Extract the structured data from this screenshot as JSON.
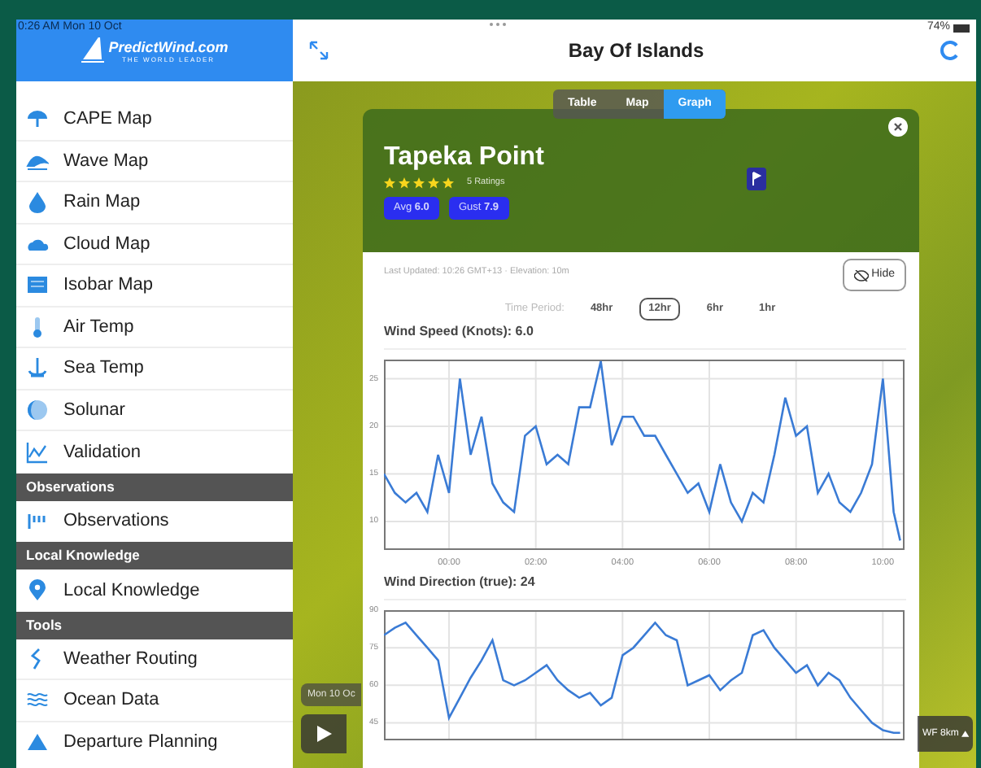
{
  "status_bar": {
    "time": "0:26 AM  Mon 10 Oct",
    "battery": "74%"
  },
  "sidebar": {
    "logo": {
      "name": "PredictWind.com",
      "tagline": "THE WORLD LEADER"
    },
    "sections": [
      {
        "items": [
          {
            "label": "CAPE Map"
          },
          {
            "label": "Wave Map"
          },
          {
            "label": "Rain Map"
          },
          {
            "label": "Cloud Map"
          },
          {
            "label": "Isobar Map"
          },
          {
            "label": "Air Temp"
          },
          {
            "label": "Sea Temp"
          },
          {
            "label": "Solunar"
          },
          {
            "label": "Validation"
          }
        ]
      },
      {
        "heading": "Observations",
        "items": [
          {
            "label": "Observations"
          }
        ]
      },
      {
        "heading": "Local Knowledge",
        "items": [
          {
            "label": "Local Knowledge"
          }
        ]
      },
      {
        "heading": "Tools",
        "items": [
          {
            "label": "Weather Routing"
          },
          {
            "label": "Ocean Data"
          },
          {
            "label": "Departure Planning"
          }
        ]
      }
    ]
  },
  "title_bar": {
    "title": "Bay Of Islands"
  },
  "view_tabs": [
    {
      "label": "Table",
      "selected": false
    },
    {
      "label": "Map",
      "selected": false
    },
    {
      "label": "Graph",
      "selected": true
    }
  ],
  "station_card": {
    "name": "Tapeka Point",
    "stars": 5,
    "ratings": "5 Ratings",
    "avg": "Avg **6.0**",
    "gust": "Gust **7.9**",
    "updated": "Last Updated: 10:26 GMT+13 · Elevation: 10m",
    "hide_button": "Hide",
    "time_period_label": "Time Period:",
    "periods": [
      {
        "label": "48hr",
        "selected": false
      },
      {
        "label": "12hr",
        "selected": true
      },
      {
        "label": "6hr",
        "selected": false
      },
      {
        "label": "1hr",
        "selected": false
      }
    ],
    "charts": [
      {
        "title": "Wind Speed (Knots): 6.0",
        "chart_data": {
          "type": "line",
          "x": [
            -1.5,
            -1.25,
            -1,
            -0.75,
            -0.5,
            -0.25,
            0,
            0.25,
            0.5,
            0.75,
            1,
            1.25,
            1.5,
            1.75,
            2,
            2.25,
            2.5,
            2.75,
            3,
            3.25,
            3.5,
            3.75,
            4,
            4.25,
            4.5,
            4.75,
            5,
            5.25,
            5.5,
            5.75,
            6,
            6.25,
            6.5,
            6.75,
            7,
            7.25,
            7.5,
            7.75,
            8,
            8.25,
            8.5,
            8.75,
            9,
            9.25,
            9.5,
            9.75,
            10,
            10.25,
            10.4
          ],
          "xlim": [
            -1.5,
            10.5
          ],
          "ylim": [
            7,
            27
          ],
          "grid": true,
          "xticks": [
            {
              "value": 0,
              "label": "00:00"
            },
            {
              "value": 2,
              "label": "02:00"
            },
            {
              "value": 4,
              "label": "04:00"
            },
            {
              "value": 6,
              "label": "06:00"
            },
            {
              "value": 8,
              "label": "08:00"
            },
            {
              "value": 10,
              "label": "10:00"
            }
          ],
          "yticks": [
            10,
            15,
            20,
            25
          ],
          "series": [
            {
              "color": "#3a7bd5",
              "values": [
                15,
                13,
                12,
                13,
                11,
                17,
                13,
                25,
                17,
                21,
                14,
                12,
                11,
                19,
                20,
                16,
                17,
                16,
                22,
                22,
                27,
                18,
                21,
                21,
                19,
                19,
                17,
                15,
                13,
                14,
                11,
                16,
                12,
                10,
                13,
                12,
                17,
                23,
                19,
                20,
                13,
                15,
                12,
                11,
                13,
                16,
                25,
                11,
                8
              ]
            }
          ]
        }
      },
      {
        "title": "Wind Direction (true): 24",
        "chart_data": {
          "type": "line",
          "x": [
            -1.5,
            -1.25,
            -1,
            -0.75,
            -0.5,
            -0.25,
            0,
            0.25,
            0.5,
            0.75,
            1,
            1.25,
            1.5,
            1.75,
            2,
            2.25,
            2.5,
            2.75,
            3,
            3.25,
            3.5,
            3.75,
            4,
            4.25,
            4.5,
            4.75,
            5,
            5.25,
            5.5,
            5.75,
            6,
            6.25,
            6.5,
            6.75,
            7,
            7.25,
            7.5,
            7.75,
            8,
            8.25,
            8.5,
            8.75,
            9,
            9.25,
            9.5,
            9.75,
            10,
            10.25,
            10.4
          ],
          "xlim": [
            -1.5,
            10.5
          ],
          "ylim": [
            38,
            90
          ],
          "grid": true,
          "yticks": [
            45,
            60,
            75,
            90
          ],
          "series": [
            {
              "color": "#3a7bd5",
              "values": [
                80,
                83,
                85,
                80,
                75,
                70,
                47,
                55,
                63,
                70,
                78,
                62,
                60,
                62,
                65,
                68,
                62,
                58,
                55,
                57,
                52,
                55,
                72,
                75,
                80,
                85,
                80,
                78,
                60,
                62,
                64,
                58,
                62,
                65,
                80,
                82,
                75,
                70,
                65,
                68,
                60,
                65,
                62,
                55,
                50,
                45,
                42,
                41,
                41
              ]
            }
          ]
        }
      }
    ]
  },
  "timeline": {
    "date": "Mon 10 Oc",
    "model": "WF 8km"
  }
}
